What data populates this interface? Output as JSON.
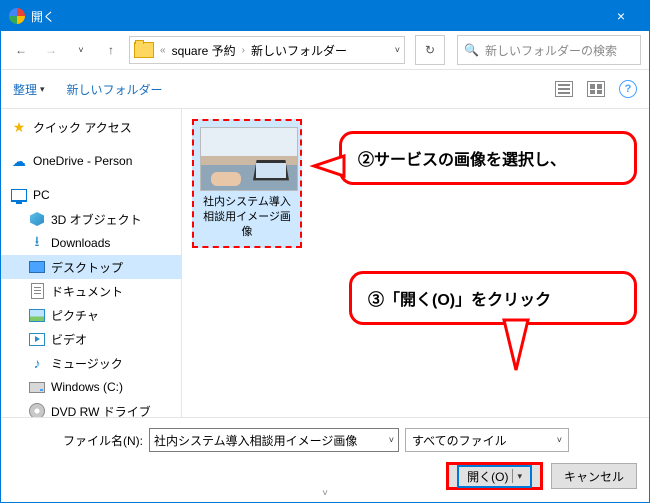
{
  "titlebar": {
    "title": "開く",
    "close": "×"
  },
  "nav": {
    "back": "←",
    "forward": "→",
    "up": "↑",
    "refresh": "↻"
  },
  "breadcrumb": {
    "items": [
      "square 予約",
      "新しいフォルダー"
    ]
  },
  "search": {
    "placeholder": "新しいフォルダーの検索"
  },
  "toolbar": {
    "organize": "整理",
    "new_folder": "新しいフォルダー",
    "help": "?"
  },
  "sidebar": {
    "quick_access": "クイック アクセス",
    "onedrive": "OneDrive - Person",
    "pc": "PC",
    "items": [
      "3D オブジェクト",
      "Downloads",
      "デスクトップ",
      "ドキュメント",
      "ピクチャ",
      "ビデオ",
      "ミュージック",
      "Windows (C:)",
      "DVD RW ドライブ"
    ]
  },
  "file": {
    "name": "社内システム導入相談用イメージ画像"
  },
  "callouts": {
    "c2": "②サービスの画像を選択し、",
    "c3": "③「開く(O)」をクリック"
  },
  "footer": {
    "filename_label": "ファイル名(N):",
    "filename_value": "社内システム導入相談用イメージ画像",
    "filetype": "すべてのファイル",
    "open": "開く(O)",
    "cancel": "キャンセル"
  }
}
